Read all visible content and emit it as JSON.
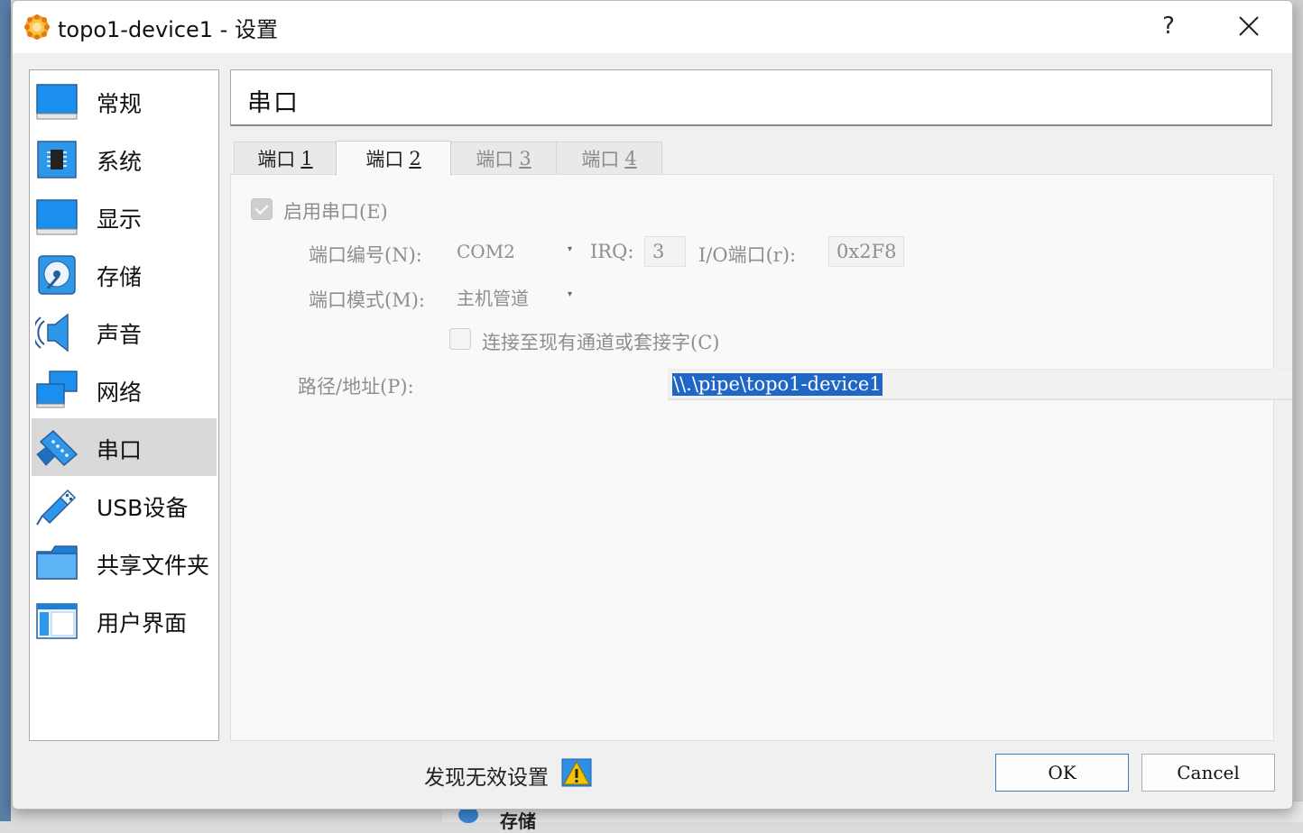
{
  "window": {
    "title": "topo1-device1 - 设置",
    "help_label": "?"
  },
  "sidebar": {
    "items": [
      {
        "label": "常规",
        "icon": "monitor-icon"
      },
      {
        "label": "系统",
        "icon": "chip-icon"
      },
      {
        "label": "显示",
        "icon": "display-icon"
      },
      {
        "label": "存储",
        "icon": "storage-disk-icon"
      },
      {
        "label": "声音",
        "icon": "speaker-icon"
      },
      {
        "label": "网络",
        "icon": "network-icon"
      },
      {
        "label": "串口",
        "icon": "serial-port-icon",
        "selected": true
      },
      {
        "label": "USB设备",
        "icon": "usb-icon"
      },
      {
        "label": "共享文件夹",
        "icon": "folder-icon"
      },
      {
        "label": "用户界面",
        "icon": "user-interface-icon"
      }
    ]
  },
  "header": {
    "title": "串口"
  },
  "tabs": [
    {
      "label": "端口",
      "num": "1",
      "state": "inactive"
    },
    {
      "label": "端口",
      "num": "2",
      "state": "active"
    },
    {
      "label": "端口",
      "num": "3",
      "state": "disabled"
    },
    {
      "label": "端口",
      "num": "4",
      "state": "disabled"
    }
  ],
  "port": {
    "enable_label": "启用串口(E)",
    "enable_checked": true,
    "port_number_label": "端口编号(N):",
    "port_number_value": "COM2",
    "irq_label": "IRQ:",
    "irq_value": "3",
    "io_port_label": "I/O端口(r):",
    "io_port_value": "0x2F8",
    "mode_label": "端口模式(M):",
    "mode_value": "主机管道",
    "connect_existing_label": "连接至现有通道或套接字(C)",
    "connect_existing_checked": false,
    "path_label": "路径/地址(P):",
    "path_value": "\\\\.\\pipe\\topo1-device1"
  },
  "footer": {
    "warning_text": "发现无效设置",
    "ok_label": "OK",
    "cancel_label": "Cancel"
  },
  "background": {
    "partial_text": "存储"
  },
  "colors": {
    "accent": "#1e67c7",
    "selected_item": "#d9d9d9",
    "ok_border": "#3a78c2",
    "warning": "#f5c400"
  }
}
